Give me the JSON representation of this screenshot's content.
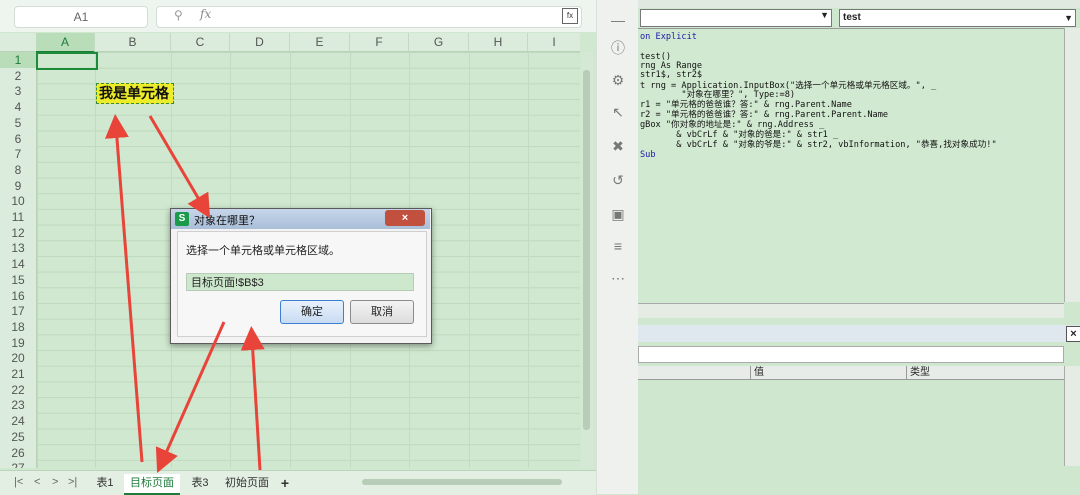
{
  "spreadsheet": {
    "name_box": "A1",
    "formula_value": "",
    "fx_label": "fx",
    "columns": [
      "A",
      "B",
      "C",
      "D",
      "E",
      "F",
      "G",
      "H",
      "I"
    ],
    "active_column": "A",
    "rows": [
      "1",
      "2",
      "3",
      "4",
      "5",
      "6",
      "7",
      "8",
      "9",
      "10",
      "11",
      "12",
      "13",
      "14",
      "15",
      "16",
      "17",
      "18",
      "19",
      "20",
      "21",
      "22",
      "23",
      "24",
      "25",
      "26",
      "27"
    ],
    "active_row": "1",
    "cell_b3": "我是单元格",
    "sheet_tabs": [
      "表1",
      "目标页面",
      "表3",
      "初始页面"
    ],
    "active_tab": "目标页面",
    "add_tab": "+",
    "nav_buttons": [
      "|<",
      "<",
      ">",
      ">|"
    ]
  },
  "vba_editor": {
    "object_combo": "",
    "procedure_combo": "test",
    "code_lines": [
      "on Explicit",
      "",
      "test()",
      "rng As Range",
      "str1$, str2$",
      "t rng = Application.InputBox(\"选择一个单元格或单元格区域。\", _",
      "        \"对象在哪里？\", Type:=8)",
      "r1 = \"单元格的爸爸谁？答:\" & rng.Parent.Name",
      "r2 = \"单元格的爸爸谁？答:\" & rng.Parent.Parent.Name",
      "gBox \"你对象的地址是:\" & rng.Address _",
      "       & vbCrLf & \"对象的爸是:\" & str1 _",
      "       & vbCrLf & \"对象的爷是:\" & str2, vbInformation, \"恭喜,找对象成功!\"",
      "Sub"
    ],
    "locals_columns": [
      "",
      "值",
      "类型"
    ],
    "close_label": "×"
  },
  "dialog": {
    "app_icon": "S",
    "title": "对象在哪里？",
    "prompt": "选择一个单元格或单元格区域。",
    "input_value": "目标页面!$B$3",
    "ok_label": "确定",
    "cancel_label": "取消",
    "close_label": "×"
  },
  "colors": {
    "sheet_bg": "#cfe8cf",
    "accent_green": "#1e7b3a",
    "cell_highlight": "#ecec2a",
    "arrow_red": "#e8443a",
    "vba_keyword": "#1a1aa8"
  }
}
